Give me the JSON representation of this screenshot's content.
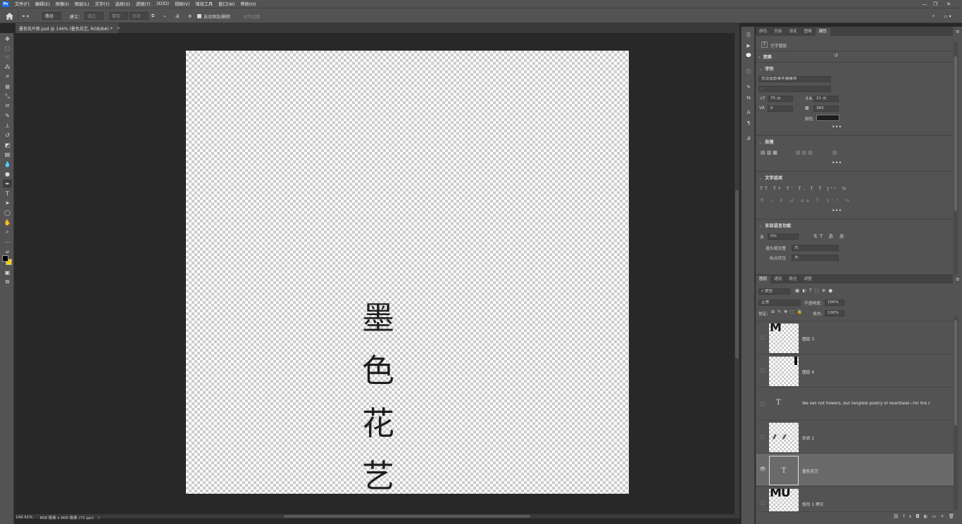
{
  "app": {
    "logo": "Ps"
  },
  "menu": [
    "文件(F)",
    "编辑(E)",
    "图像(I)",
    "图层(L)",
    "文字(Y)",
    "选择(S)",
    "滤镜(T)",
    "3D(D)",
    "视图(V)",
    "增效工具",
    "窗口(W)",
    "帮助(H)"
  ],
  "window_controls": {
    "minimize": "—",
    "restore": "❐",
    "close": "✕"
  },
  "options": {
    "mode_value": "路径",
    "make_label": "建立：",
    "selection_label": "选区",
    "mask_label": "蒙版",
    "shape_label": "形状",
    "auto_add_label": "自动添加/删除",
    "align_edges_label": "对齐边缘"
  },
  "document_tab": {
    "title": "墨色花片新.psd @ 146% (墨色花艺, RGB/8#) *",
    "close": "×"
  },
  "canvas": {
    "chars": [
      "墨",
      "色",
      "花",
      "艺"
    ]
  },
  "status": {
    "zoom": "146.41%",
    "dimensions": "808 像素 x 808 像素 (72 ppi)",
    "arrow": "〉"
  },
  "props_panel": {
    "tabs": [
      "颜色",
      "色板",
      "渐变",
      "图案",
      "属性"
    ],
    "active_tab": "属性",
    "layer_kind": "文字图层",
    "transform_label": "变换",
    "character_label": "字符",
    "font_family": "优设造鱼事件健康体",
    "font_style": "-",
    "font_size": "75 点",
    "leading": "21 点",
    "kerning": "0",
    "tracking": "360",
    "color_label": "颜色",
    "color_value": "#1f1f1f",
    "paragraph_label": "段落",
    "text_options_label": "文字选项",
    "east_asian_label": "东亚语言功能",
    "tsume": "0%",
    "kinsoku_label": "避头尾设置",
    "kinsoku_value": "无",
    "mojikumi_label": "标点挤压",
    "mojikumi_value": "无",
    "more": "•••"
  },
  "layers_panel": {
    "tabs": [
      "图层",
      "通道",
      "路径",
      "调整"
    ],
    "active_tab": "图层",
    "filter_kind": "类型",
    "blend_mode": "正常",
    "opacity_label": "不透明度:",
    "opacity_value": "100%",
    "lock_label": "锁定:",
    "fill_label": "填充:",
    "fill_value": "100%",
    "layers": [
      {
        "name": "图层 3",
        "type": "pixel",
        "visible": false,
        "selected": false,
        "thumb_text": "M"
      },
      {
        "name": "图层 4",
        "type": "pixel",
        "visible": false,
        "selected": false,
        "thumb_text": ""
      },
      {
        "name": "We sell not flowers, but tangible poetry of heartbeat—for the c",
        "type": "text",
        "visible": false,
        "selected": false,
        "thumb_text": "T"
      },
      {
        "name": "形状 1",
        "type": "shape",
        "visible": false,
        "selected": false,
        "thumb_text": ""
      },
      {
        "name": "墨色花艺",
        "type": "text",
        "visible": true,
        "selected": true,
        "thumb_text": "T"
      },
      {
        "name": "矩形 1 拷贝",
        "type": "pixel",
        "visible": false,
        "selected": false,
        "thumb_text": "MU"
      }
    ]
  }
}
